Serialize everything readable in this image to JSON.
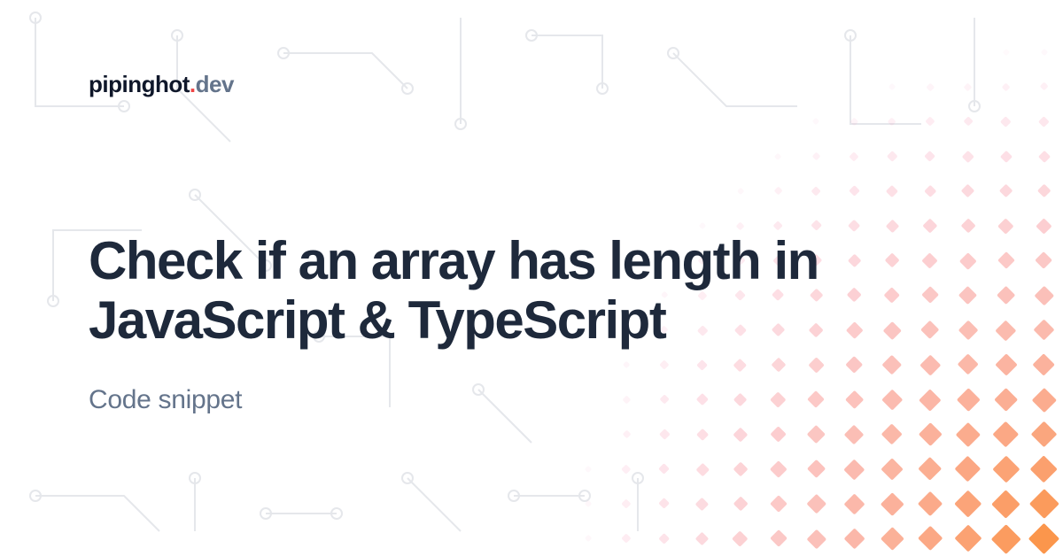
{
  "logo": {
    "name": "pipinghot",
    "sep": ".",
    "tld": "dev"
  },
  "title": "Check if an array has length in JavaScript & TypeScript",
  "subtitle": "Code snippet",
  "colors": {
    "accent": "#ef4444",
    "ink": "#1e293b",
    "muted": "#64748b"
  }
}
